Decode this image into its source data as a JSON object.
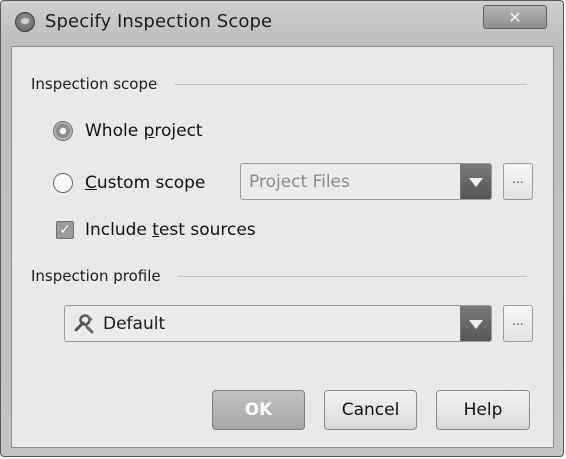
{
  "window": {
    "title": "Specify Inspection Scope",
    "close_icon": "close-icon"
  },
  "scope_group": {
    "label": "Inspection scope",
    "options": [
      {
        "label_pre": "Whole ",
        "label_u": "p",
        "label_post": "roject",
        "selected": true
      },
      {
        "label_pre": "",
        "label_u": "C",
        "label_post": "ustom scope",
        "selected": false
      }
    ],
    "custom_scope_combo": {
      "value": "Project Files",
      "enabled": false
    },
    "ellipsis_label": "...",
    "include_tests": {
      "label_pre": "Include ",
      "label_u": "t",
      "label_post": "est sources",
      "checked": true,
      "check_glyph": "✓"
    }
  },
  "profile_group": {
    "label": "Inspection profile",
    "combo": {
      "value": "Default"
    },
    "ellipsis_label": "..."
  },
  "buttons": {
    "ok": "OK",
    "cancel": "Cancel",
    "help": "Help"
  }
}
